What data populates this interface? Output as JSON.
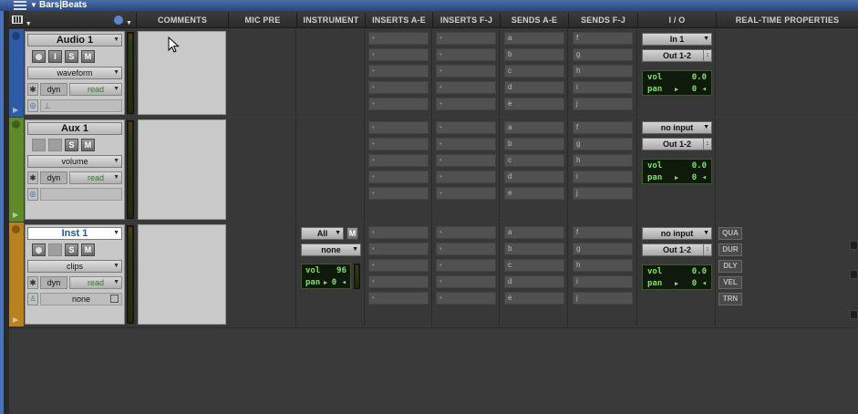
{
  "window": {
    "title": "Bars|Beats"
  },
  "header": {
    "columns": [
      "COMMENTS",
      "MIC PRE",
      "INSTRUMENT",
      "INSERTS A-E",
      "INSERTS F-J",
      "SENDS A-E",
      "SENDS F-J",
      "I / O",
      "REAL-TIME PROPERTIES"
    ]
  },
  "glyphs": {
    "dropdown": "▼",
    "play": "▶",
    "snow": "✱",
    "nudge": "◂",
    "side": "↕"
  },
  "tracks": [
    {
      "name": "Audio 1",
      "color": "#2f5aa6",
      "buttons": [
        "",
        "I",
        "S",
        "M"
      ],
      "view": "waveform",
      "dyn": "dyn",
      "automation": "read",
      "sends_ae": [
        "a",
        "b",
        "c",
        "d",
        "e"
      ],
      "sends_fj": [
        "f",
        "g",
        "h",
        "i",
        "j"
      ],
      "input": "In 1",
      "output": "Out 1-2",
      "vol_label": "vol",
      "vol": "0.0",
      "pan_label": "pan",
      "pan": "0"
    },
    {
      "name": "Aux 1",
      "color": "#5f8a2a",
      "buttons": [
        "S",
        "M"
      ],
      "view": "volume",
      "dyn": "dyn",
      "automation": "read",
      "sends_ae": [
        "a",
        "b",
        "c",
        "d",
        "e"
      ],
      "sends_fj": [
        "f",
        "g",
        "h",
        "i",
        "j"
      ],
      "input": "no input",
      "output": "Out 1-2",
      "vol_label": "vol",
      "vol": "0.0",
      "pan_label": "pan",
      "pan": "0"
    },
    {
      "name": "Inst 1",
      "color": "#b88220",
      "buttons": [
        "",
        "S",
        "M"
      ],
      "view": "clips",
      "dyn": "dyn",
      "automation": "read",
      "group": "none",
      "instrument": {
        "channel": "All",
        "m": "M",
        "patch": "none",
        "vol_label": "vol",
        "vol": "96",
        "pan_label": "pan",
        "pan": "0"
      },
      "sends_ae": [
        "a",
        "b",
        "c",
        "d",
        "e"
      ],
      "sends_fj": [
        "f",
        "g",
        "h",
        "i",
        "j"
      ],
      "input": "no input",
      "output": "Out 1-2",
      "vol_label": "vol",
      "vol": "0.0",
      "pan_label": "pan",
      "pan": "0",
      "realtime": [
        "QUA",
        "DUR",
        "DLY",
        "VEL",
        "TRN"
      ]
    }
  ]
}
